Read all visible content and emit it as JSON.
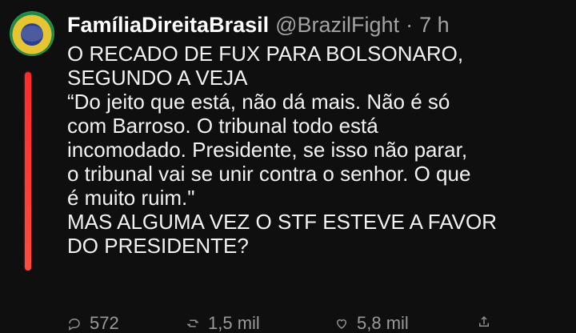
{
  "tweet": {
    "display_name": "FamíliaDireitaBrasil",
    "handle": "@BrazilFight",
    "separator": "·",
    "time": "7 h",
    "lines": [
      "O RECADO DE FUX PARA BOLSONARO,",
      "SEGUNDO A VEJA",
      "“Do jeito que está, não dá mais. Não é só",
      "com Barroso. O tribunal todo está",
      "incomodado. Presidente, se isso não parar,",
      "o tribunal vai se unir contra o senhor. O que",
      "é muito ruim.\"",
      "MAS ALGUMA VEZ O STF ESTEVE A FAVOR",
      "DO PRESIDENTE?"
    ]
  },
  "actions": {
    "reply_count": "572",
    "retweet_count": "1,5 mil",
    "like_count": "5,8 mil"
  },
  "icons": {
    "avatar": "avatar",
    "reply": "reply-icon",
    "retweet": "retweet-icon",
    "like": "heart-icon",
    "share": "share-icon"
  },
  "colors": {
    "background": "#0f0f10",
    "text": "#f2f2f2",
    "muted": "#a3a3a3",
    "thread_line": "#ff3a2f"
  }
}
